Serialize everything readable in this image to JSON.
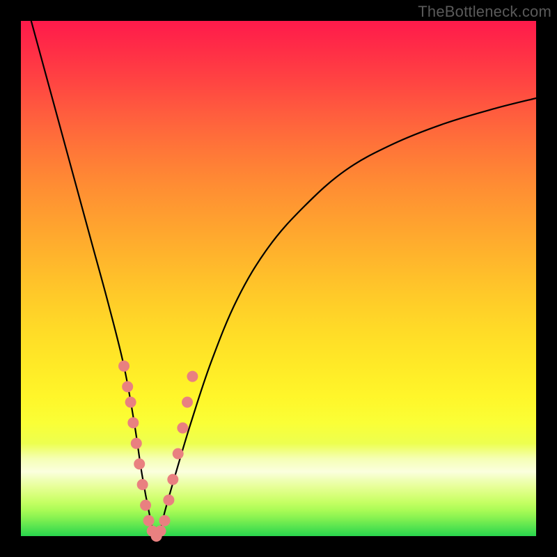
{
  "watermark": "TheBottleneck.com",
  "colors": {
    "gradient_top": "#ff1a4b",
    "gradient_mid": "#ffe327",
    "gradient_bottom": "#29d64d",
    "curve_stroke": "#000000",
    "marker_fill": "#e98080",
    "marker_stroke": "#d26a6a",
    "frame_background": "#000000",
    "watermark_color": "#5a5a5a"
  },
  "chart_data": {
    "type": "line",
    "title": "",
    "xlabel": "",
    "ylabel": "",
    "xlim": [
      0,
      100
    ],
    "ylim": [
      0,
      100
    ],
    "grid": false,
    "legend": "none",
    "series": [
      {
        "name": "bottleneck-curve",
        "x": [
          2,
          5,
          8,
          11,
          14,
          17,
          20,
          22,
          23.5,
          25,
          26,
          27,
          28,
          30,
          33,
          37,
          42,
          48,
          55,
          63,
          72,
          82,
          92,
          100
        ],
        "y": [
          100,
          89,
          78,
          67,
          56,
          45,
          33,
          22,
          12,
          4,
          0,
          1,
          5,
          12,
          22,
          34,
          46,
          56,
          64,
          71,
          76,
          80,
          83,
          85
        ]
      }
    ],
    "markers": {
      "name": "highlight-points",
      "x": [
        20.0,
        20.7,
        21.3,
        21.8,
        22.4,
        23.0,
        23.6,
        24.2,
        24.8,
        25.5,
        26.3,
        27.1,
        27.9,
        28.7,
        29.5,
        30.5,
        31.4,
        32.3,
        33.3
      ],
      "y": [
        33,
        29,
        26,
        22,
        18,
        14,
        10,
        6,
        3,
        1,
        0,
        1,
        3,
        7,
        11,
        16,
        21,
        26,
        31
      ]
    },
    "annotations": []
  }
}
